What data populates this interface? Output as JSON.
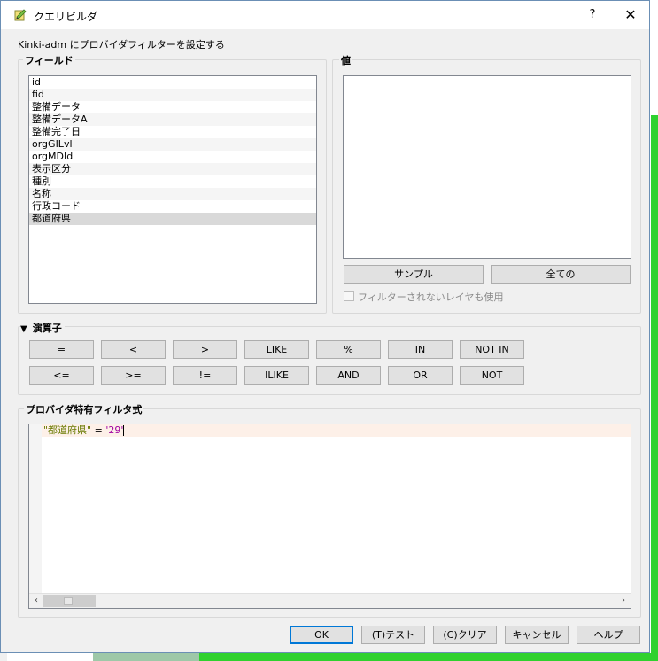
{
  "dialog": {
    "title": "クエリビルダ",
    "help_label": "?",
    "close_label": "✕",
    "subtitle": "Kinki-adm にプロバイダフィルターを設定する"
  },
  "fields": {
    "label": "フィールド",
    "items": [
      "id",
      "fid",
      "整備データ",
      "整備データA",
      "整備完了日",
      "orgGILvl",
      "orgMDId",
      "表示区分",
      "種別",
      "名称",
      "行政コード",
      "都道府県"
    ],
    "selected_index": 11
  },
  "values": {
    "label": "値",
    "sample_button": "サンプル",
    "all_button": "全ての",
    "use_unfiltered_label": "フィルターされないレイヤも使用"
  },
  "operators": {
    "label": "演算子",
    "row1": [
      "=",
      "<",
      ">",
      "LIKE",
      "%",
      "IN",
      "NOT IN"
    ],
    "row2": [
      "<=",
      ">=",
      "!=",
      "ILIKE",
      "AND",
      "OR",
      "NOT"
    ]
  },
  "expression": {
    "label": "プロバイダ特有フィルタ式",
    "field_token": "\"都道府県\"",
    "op_token": " = ",
    "value_token": "'29'"
  },
  "footer": {
    "ok": "OK",
    "test": "(T)テスト",
    "clear": "(C)クリア",
    "cancel": "キャンセル",
    "help": "ヘルプ"
  },
  "colors": {
    "field_token": "#6a7a00",
    "value_token": "#a000a0",
    "selected_row": "#d9d9d9",
    "map_green": "#2fd12f"
  }
}
